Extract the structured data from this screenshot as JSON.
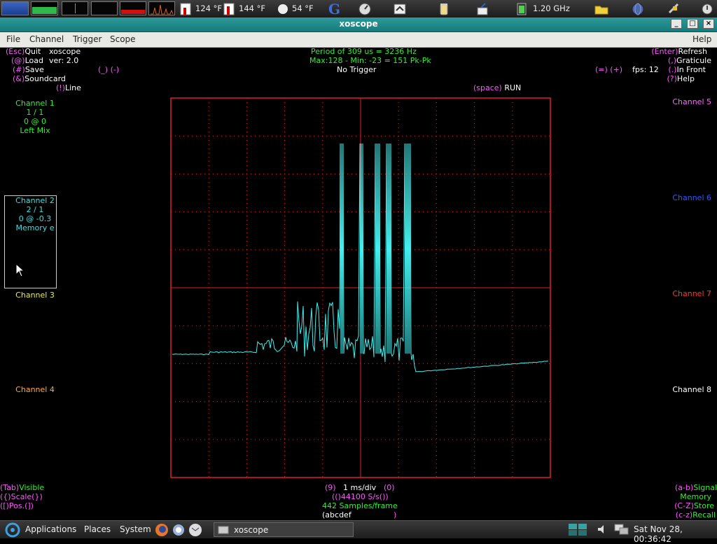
{
  "top_panel": {
    "temp1": "124 °F",
    "temp2": "144 °F",
    "weather": "54 °F",
    "cpu_freq": "1.20 GHz"
  },
  "window": {
    "title": "xoscope"
  },
  "menubar": {
    "file": "File",
    "channel": "Channel",
    "trigger": "Trigger",
    "scope": "Scope",
    "help": "Help"
  },
  "left_keys": {
    "quit_key": "(Esc)",
    "quit_label": "Quit",
    "app_name": "xoscope",
    "load_key": "(@)",
    "load_label": "Load",
    "version": "ver: 2.0",
    "save_key": "(#)",
    "save_label": "Save",
    "soundcard_key": "(&)",
    "soundcard_label": "Soundcard",
    "line_key": "(!)",
    "line_label": "Line",
    "underscore_keys": "(_) (-)"
  },
  "measure": {
    "period": "Period of   309 us =  3236 Hz",
    "maxmin": "Max:128 - Min: -23 = 151 Pk-Pk",
    "trigger": "No Trigger",
    "run_key": "(space)",
    "run_label": "RUN"
  },
  "right_keys": {
    "refresh_key": "(Enter)",
    "refresh_label": "Refresh",
    "graticule_key": "(,)",
    "graticule_label": "Graticule",
    "infront_key": "(.)",
    "infront_label": "In Front",
    "help_key": "(?)",
    "help_label": "Help",
    "fps_keys": "(=) (+)",
    "fps": "fps: 12"
  },
  "channels_left": {
    "ch1": {
      "name": "Channel 1",
      "scale": "1 / 1",
      "pos": "0 @ 0",
      "source": "Left Mix"
    },
    "ch2": {
      "name": "Channel 2",
      "scale": "2 / 1",
      "pos": "0 @ -0.3",
      "source": "Memory e"
    },
    "ch3": {
      "name": "Channel 3"
    },
    "ch4": {
      "name": "Channel 4"
    }
  },
  "channels_right": {
    "ch5": "Channel 5",
    "ch6": "Channel 6",
    "ch7": "Channel 7",
    "ch8": "Channel 8"
  },
  "bottom_left": {
    "visible_key": "(Tab)",
    "visible_label": "Visible",
    "scale": "({)Scale(})",
    "pos": "([)Pos.(])"
  },
  "bottom_center": {
    "timebase_dec": "(9)",
    "timebase": "1 ms/div",
    "timebase_inc": "(0)",
    "rate": "(()44100 S/s())",
    "samples": "442 Samples/frame",
    "mem": "(abcdef",
    "mem_close": ")"
  },
  "bottom_right": {
    "signal_key": "(a-b)",
    "signal_label": "Signal",
    "memory_label": "Memory",
    "store_key": "(C-Z)",
    "store_label": "Store",
    "recall_key": "(c-z)",
    "recall_label": "Recall"
  },
  "bottom_panel": {
    "applications": "Applications",
    "places": "Places",
    "system": "System",
    "task": "xoscope",
    "clock": "Sat Nov 28, 00:36:42"
  },
  "colors": {
    "trace": "#44eeee",
    "grid": "#e02020",
    "ch1": "#33ee33",
    "ch2": "#44dddd",
    "ch3": "#eeee33",
    "ch4": "#ffaa33",
    "ch5": "#ff66ff",
    "ch6": "#3355ff",
    "ch7": "#ff3333",
    "ch8": "#ffffff"
  }
}
